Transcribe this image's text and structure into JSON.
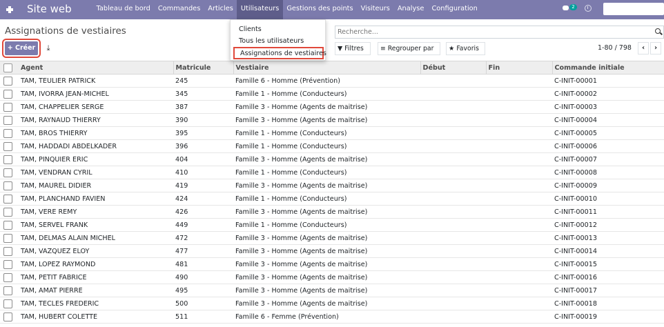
{
  "navbar": {
    "brand": "Site web",
    "menu": [
      {
        "label": "Tableau de bord"
      },
      {
        "label": "Commandes"
      },
      {
        "label": "Articles"
      },
      {
        "label": "Utilisateurs",
        "active": true
      },
      {
        "label": "Gestions des points"
      },
      {
        "label": "Visiteurs"
      },
      {
        "label": "Analyse"
      },
      {
        "label": "Configuration"
      }
    ],
    "chat_count": "2"
  },
  "dropdown": {
    "items": [
      "Clients",
      "Tous les utilisateurs",
      "Assignations de vestiaires"
    ],
    "selected_index": 2
  },
  "control_panel": {
    "title": "Assignations de vestiaires",
    "create_label": "+ Créer",
    "search_placeholder": "Recherche...",
    "filters_label": "Filtres",
    "group_label": "Regrouper par",
    "favorites_label": "Favoris",
    "pager": "1-80 / 798",
    "prev": "‹",
    "next": "›"
  },
  "table": {
    "columns": [
      "Agent",
      "Matricule",
      "Vestiaire",
      "Début",
      "Fin",
      "Commande initiale"
    ],
    "rows": [
      [
        "TAM, TEULIER PATRICK",
        "245",
        "Famille 6 - Homme (Prévention)",
        "",
        "",
        "C-INIT-00001"
      ],
      [
        "TAM, IVORRA JEAN-MICHEL",
        "345",
        "Famille 1 - Homme (Conducteurs)",
        "",
        "",
        "C-INIT-00002"
      ],
      [
        "TAM, CHAPPELIER SERGE",
        "387",
        "Famille 3 - Homme (Agents de maitrise)",
        "",
        "",
        "C-INIT-00003"
      ],
      [
        "TAM, RAYNAUD THIERRY",
        "390",
        "Famille 3 - Homme (Agents de maitrise)",
        "",
        "",
        "C-INIT-00004"
      ],
      [
        "TAM, BROS THIERRY",
        "395",
        "Famille 1 - Homme (Conducteurs)",
        "",
        "",
        "C-INIT-00005"
      ],
      [
        "TAM, HADDADI ABDELKADER",
        "396",
        "Famille 1 - Homme (Conducteurs)",
        "",
        "",
        "C-INIT-00006"
      ],
      [
        "TAM, PINQUIER ERIC",
        "404",
        "Famille 3 - Homme (Agents de maitrise)",
        "",
        "",
        "C-INIT-00007"
      ],
      [
        "TAM, VENDRAN CYRIL",
        "410",
        "Famille 1 - Homme (Conducteurs)",
        "",
        "",
        "C-INIT-00008"
      ],
      [
        "TAM, MAUREL DIDIER",
        "419",
        "Famille 3 - Homme (Agents de maitrise)",
        "",
        "",
        "C-INIT-00009"
      ],
      [
        "TAM, PLANCHAND FAVIEN",
        "424",
        "Famille 1 - Homme (Conducteurs)",
        "",
        "",
        "C-INIT-00010"
      ],
      [
        "TAM, VERE REMY",
        "426",
        "Famille 3 - Homme (Agents de maitrise)",
        "",
        "",
        "C-INIT-00011"
      ],
      [
        "TAM, SERVEL FRANK",
        "449",
        "Famille 1 - Homme (Conducteurs)",
        "",
        "",
        "C-INIT-00012"
      ],
      [
        "TAM, DELMAS ALAIN MICHEL",
        "472",
        "Famille 3 - Homme (Agents de maitrise)",
        "",
        "",
        "C-INIT-00013"
      ],
      [
        "TAM, VAZQUEZ ELOY",
        "477",
        "Famille 3 - Homme (Agents de maitrise)",
        "",
        "",
        "C-INIT-00014"
      ],
      [
        "TAM, LOPEZ RAYMOND",
        "481",
        "Famille 3 - Homme (Agents de maitrise)",
        "",
        "",
        "C-INIT-00015"
      ],
      [
        "TAM, PETIT FABRICE",
        "490",
        "Famille 3 - Homme (Agents de maitrise)",
        "",
        "",
        "C-INIT-00016"
      ],
      [
        "TAM, AMAT PIERRE",
        "495",
        "Famille 3 - Homme (Agents de maitrise)",
        "",
        "",
        "C-INIT-00017"
      ],
      [
        "TAM, TECLES FREDERIC",
        "500",
        "Famille 3 - Homme (Agents de maitrise)",
        "",
        "",
        "C-INIT-00018"
      ],
      [
        "TAM, HUBERT COLETTE",
        "511",
        "Famille 6 - Femme (Prévention)",
        "",
        "",
        "C-INIT-00019"
      ]
    ]
  }
}
